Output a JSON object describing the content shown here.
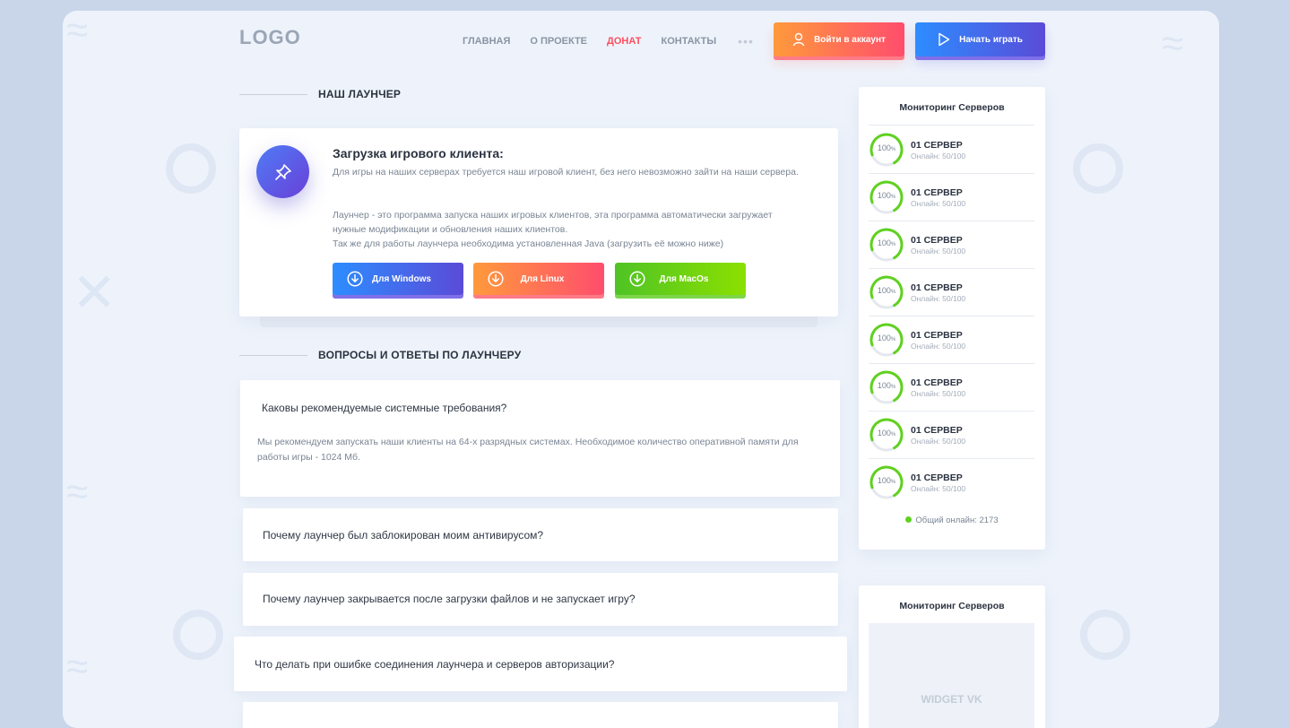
{
  "header": {
    "logo": "LOGO",
    "nav": [
      {
        "label": "ГЛАВНАЯ",
        "active": false
      },
      {
        "label": "О ПРОЕКТЕ",
        "active": false
      },
      {
        "label": "ДОНАТ",
        "active": true
      },
      {
        "label": "КОНТАКТЫ",
        "active": false
      }
    ],
    "more": "•••",
    "login_label": "Войти в аккаунт",
    "play_label": "Начать играть"
  },
  "launcher": {
    "section_title": "НАШ ЛАУНЧЕР",
    "title": "Загрузка игрового клиента:",
    "p1": "Для игры на наших серверах требуется наш игровой клиент, без него невозможно зайти на наши сервера.",
    "p2": "Лаунчер - это программа запуска наших игровых клиентов, эта программа автоматически загружает нужные модификации и обновления наших клиентов.",
    "p3": "Так же для работы лаунчера необходима установленная Java (загрузить её можно ниже)",
    "buttons": {
      "windows": "Для Windows",
      "linux": "Для Linux",
      "macos": "Для MacOs"
    }
  },
  "faq": {
    "section_title": "ВОПРОСЫ И ОТВЕТЫ ПО ЛАУНЧЕРУ",
    "items": [
      {
        "q": "Каковы рекомендуемые системные требования?",
        "a": "Мы рекомендуем запускать наши клиенты на 64-х разрядных системах. Необходимое количество оперативной памяти для работы игры - 1024 Мб."
      },
      {
        "q": "Почему лаунчер был заблокирован моим антивирусом?"
      },
      {
        "q": "Почему лаунчер закрывается после загрузки файлов и не запускает игру?"
      },
      {
        "q": "Что делать при ошибке соединения лаунчера и серверов авторизации?"
      }
    ]
  },
  "monitoring": {
    "title": "Мониторинг Серверов",
    "servers": [
      {
        "name": "01 СЕРВЕР",
        "online": "Онлайн: 50/100",
        "percent": 100,
        "percent_label": "100"
      },
      {
        "name": "01 СЕРВЕР",
        "online": "Онлайн: 50/100",
        "percent": 100,
        "percent_label": "100"
      },
      {
        "name": "01 СЕРВЕР",
        "online": "Онлайн: 50/100",
        "percent": 100,
        "percent_label": "100"
      },
      {
        "name": "01 СЕРВЕР",
        "online": "Онлайн: 50/100",
        "percent": 100,
        "percent_label": "100"
      },
      {
        "name": "01 СЕРВЕР",
        "online": "Онлайн: 50/100",
        "percent": 100,
        "percent_label": "100"
      },
      {
        "name": "01 СЕРВЕР",
        "online": "Онлайн: 50/100",
        "percent": 100,
        "percent_label": "100"
      },
      {
        "name": "01 СЕРВЕР",
        "online": "Онлайн: 50/100",
        "percent": 100,
        "percent_label": "100"
      },
      {
        "name": "01 СЕРВЕР",
        "online": "Онлайн: 50/100",
        "percent": 100,
        "percent_label": "100"
      }
    ],
    "percent_unit": "%",
    "total": "Общий онлайн: 2173"
  },
  "monitoring2": {
    "title": "Мониторинг Серверов",
    "widget": "WIDGET VK"
  },
  "colors": {
    "accent_red": "#ff4d5e",
    "gradient_blue": [
      "#2d8dff",
      "#5a4bd8"
    ],
    "gradient_orange": [
      "#ff9a3c",
      "#ff4d6d"
    ],
    "gradient_green": [
      "#4fc325",
      "#8be000"
    ],
    "online_green": "#5fd11f"
  },
  "icons": {
    "login": "user-icon",
    "play": "play-icon",
    "launcher": "pin-icon",
    "download": "download-icon"
  }
}
